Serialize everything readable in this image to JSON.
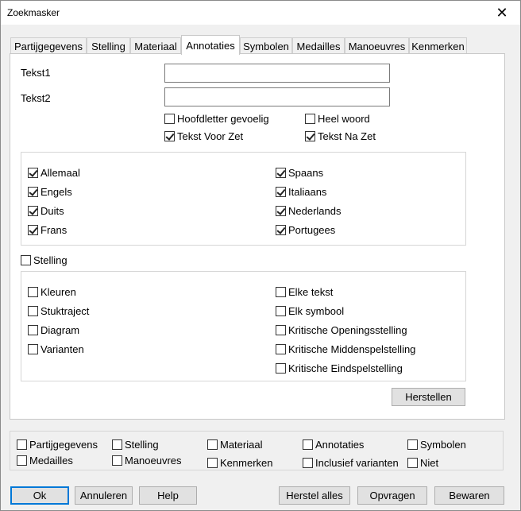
{
  "window": {
    "title": "Zoekmasker",
    "close_glyph": "✕"
  },
  "tabs": [
    {
      "label": "Partijgegevens",
      "active": false
    },
    {
      "label": "Stelling",
      "active": false
    },
    {
      "label": "Materiaal",
      "active": false
    },
    {
      "label": "Annotaties",
      "active": true
    },
    {
      "label": "Symbolen",
      "active": false
    },
    {
      "label": "Medailles",
      "active": false
    },
    {
      "label": "Manoeuvres",
      "active": false
    },
    {
      "label": "Kenmerken",
      "active": false
    }
  ],
  "fields": {
    "tekst1": {
      "label": "Tekst1",
      "value": ""
    },
    "tekst2": {
      "label": "Tekst2",
      "value": ""
    }
  },
  "options": {
    "hoofdletter": {
      "label": "Hoofdletter gevoelig",
      "checked": false
    },
    "heel_woord": {
      "label": "Heel woord",
      "checked": false
    },
    "tekst_voor_zet": {
      "label": "Tekst Voor Zet",
      "checked": true
    },
    "tekst_na_zet": {
      "label": "Tekst Na Zet",
      "checked": true
    }
  },
  "languages": {
    "allemaal": {
      "label": "Allemaal",
      "checked": true
    },
    "engels": {
      "label": "Engels",
      "checked": true
    },
    "duits": {
      "label": "Duits",
      "checked": true
    },
    "frans": {
      "label": "Frans",
      "checked": true
    },
    "spaans": {
      "label": "Spaans",
      "checked": true
    },
    "italiaans": {
      "label": "Italiaans",
      "checked": true
    },
    "nederlands": {
      "label": "Nederlands",
      "checked": true
    },
    "portugees": {
      "label": "Portugees",
      "checked": true
    }
  },
  "stelling": {
    "label": "Stelling",
    "checked": false
  },
  "content_types": {
    "kleuren": {
      "label": "Kleuren",
      "checked": false
    },
    "stuktraject": {
      "label": "Stuktraject",
      "checked": false
    },
    "diagram": {
      "label": "Diagram",
      "checked": false
    },
    "varianten": {
      "label": "Varianten",
      "checked": false
    },
    "elke_tekst": {
      "label": "Elke tekst",
      "checked": false
    },
    "elk_symbool": {
      "label": "Elk symbool",
      "checked": false
    },
    "kritische_opening": {
      "label": "Kritische Openingsstelling",
      "checked": false
    },
    "kritische_midden": {
      "label": "Kritische Middenspelstelling",
      "checked": false
    },
    "kritische_eind": {
      "label": "Kritische Eindspelstelling",
      "checked": false
    }
  },
  "herstellen_label": "Herstellen",
  "summary": {
    "partijgegevens": {
      "label": "Partijgegevens",
      "checked": false
    },
    "stelling": {
      "label": "Stelling",
      "checked": false
    },
    "materiaal": {
      "label": "Materiaal",
      "checked": false
    },
    "annotaties": {
      "label": "Annotaties",
      "checked": false
    },
    "symbolen": {
      "label": "Symbolen",
      "checked": false
    },
    "medailles": {
      "label": "Medailles",
      "checked": false
    },
    "manoeuvres": {
      "label": "Manoeuvres",
      "checked": false
    },
    "kenmerken": {
      "label": "Kenmerken",
      "checked": false
    },
    "inclusief_varianten": {
      "label": "Inclusief varianten",
      "checked": false
    },
    "niet": {
      "label": "Niet",
      "checked": false
    }
  },
  "buttons": {
    "ok": "Ok",
    "annuleren": "Annuleren",
    "help": "Help",
    "herstel_alles": "Herstel alles",
    "opvragen": "Opvragen",
    "bewaren": "Bewaren"
  },
  "colors": {
    "focus_border": "#0078d7",
    "button_face": "#e1e1e1",
    "dialog_bg": "#f0f0f0"
  }
}
